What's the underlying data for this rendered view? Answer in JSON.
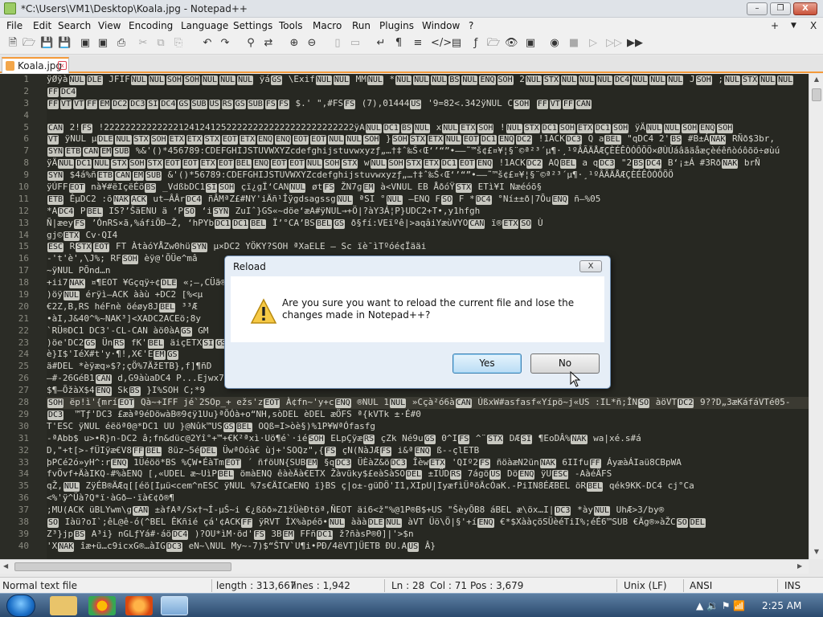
{
  "window": {
    "title": "*C:\\Users\\VM1\\Desktop\\Koala.jpg - Notepad++",
    "minimize": "–",
    "maximize": "❐",
    "close": "X"
  },
  "menu": [
    "File",
    "Edit",
    "Search",
    "View",
    "Encoding",
    "Language",
    "Settings",
    "Tools",
    "Macro",
    "Run",
    "Plugins",
    "Window",
    "?"
  ],
  "menu_right": {
    "plus": "+",
    "down": "▼",
    "close": "X"
  },
  "tab": {
    "label": "Koala.jpg",
    "close": "x"
  },
  "toolbar_icons": [
    "new-file-icon",
    "open-file-icon",
    "save-icon",
    "save-all-icon",
    "close-icon",
    "close-all-icon",
    "print-icon",
    "cut-icon",
    "copy-icon",
    "paste-icon",
    "undo-icon",
    "redo-icon",
    "find-icon",
    "replace-icon",
    "zoom-in-icon",
    "zoom-out-icon",
    "sync-v-icon",
    "sync-h-icon",
    "word-wrap-icon",
    "show-all-chars-icon",
    "indent-guide-icon",
    "udl-icon",
    "doc-map-icon",
    "function-list-icon",
    "folder-workspace-icon",
    "monitoring-icon",
    "record-macro-icon",
    "stop-record-icon",
    "play-macro-icon",
    "run-macro-multiple-icon",
    "save-macro-icon"
  ],
  "line_numbers": [
    "1",
    "2",
    "3",
    "4",
    "5",
    "6",
    "7",
    "8",
    "9",
    "10",
    "11",
    "12",
    "13",
    "14",
    "15",
    "16",
    "17",
    "18",
    "19",
    "20",
    "21",
    "22",
    "23",
    "24",
    "25",
    "26",
    "27",
    "28",
    "29",
    "30",
    "31",
    "32",
    "33",
    "34",
    "35",
    "36",
    "37",
    "38",
    "39",
    "40"
  ],
  "code_lines": [
    "ÿØÿà NUL DLE JFIF NUL NUL SOH SOH NUL NUL NUL ÿá GS \\Exif NUL NUL MM NUL * NUL NUL NUL BS NUL ENQ SOH 2 NUL STX NUL NUL NUL DC4 NUL NUL NUL J SOH ; NUL STX NUL NUL",
    "FF DC4",
    "FF VT VT FF EM DC2 DC3 SI DC4 GS SUB US RS GS SUB FS FS $.' \",#FS FS (7),01444 US '9=82<.342ÿNUL C SOH         FF VT FF CAN",
    "",
    "CAN 2! FS !22222222222222124124125222222222222222222222222ÿA NUL DC1 BS NUL x NUL ETX SOH ! NUL STX DC1 SOH ETX DC1 SOH ÿÄ NUL NUL SOH ENQ SOH",
    "VT ÿNUL µ DLE NUL STX SOH ETX ETX STX EOT ETX ENQ ENQ EOT EOT NUL NUL SOH } SOH STX ETX NUL EOT DC1 ENQ DC2 !1ACK DC3 Q a BEL \"qDC4 2' BS #B±Á NAK RÑð$3br,",
    "SYN ETB CAN EM SUB %&'()*456789:CDEFGHIJSTUVWXYZcdefghijstuvwxyzƒ„…†‡ˆ‰Š‹Œ‘’“”•–—˜™š¢£¤¥¦§¨©ª²³´µ¶·¸¹ºÂÃÄÅÆÇÈÉÊÒÓÔÕÖ×ØÙÚáâãäåæçèéêñòóôõö÷øùú",
    "ÿÄ NUL DC1 NUL STX SOH STX EOT EOT ETX EOT BEL ENQ EOT EOT NUL SOH STX w NUL SOH STX ETX DC1 EOT ENQ !1ACK DC2 AQ BEL a q DC3 \"2 BS DC4 B‘¡±Á  #3Rð NAK brÑ",
    "SYN $4á%ñ ETB CAN EM SUB &'()*56789:CDEFGHIJSTUVWXYZcdefghijstuvwxyzƒ„…†‡ˆ‰Š‹Œ‘’“”•–—˜™š¢£¤¥¦§¨©ª²³´µ¶·¸¹ºÂÃÄÅÆÇÈÉÊÒÓÔÕÖ",
    "ÿÚFF EOT nà¥#ëIçëÉö BS _VdßbDC1 SI SOH çï¿gÏ‘CAN NUL øt FS ŽN7g EM à<VNUL EB ÅðóŸ STX ETì¥I Næéóõ§",
    "ETB ÊµDC2 :õ NAK ACK ut–ÂÂr DC4 ñÂMªZ£#NY'iÄñ¹Îÿgdsagssg NUL ªSI ° NUL —ENQ F SO F * DC4 °Ní±±ð|7Õu ENQ ñ–%05",
    "*A DC4 P BEL IS?’ŠäENU ä ‘P SO ‘i SYN ZuIˆ}GS«~döe‘æA#ÿNUL→+Ö|?àY3Á¦P}UDC2+T•,y1hfgh",
    "Ñ|æey FS ’ÓnRS×ã,%áfiÖÐ–Ž,  ‘hPYb DC1 DC1 BEL Ï’°CA’BS BEL GS ð§fí:VEïºê|>aqâiYæùVYO CAN ï® ETX SO Ù",
    "gj© ETX Cv·QI4",
    "ESC R STX EOT FT ÀtàóYÅZw0hü SYN µ×DC2 YÖKY?SOH ªXaELE – Sc ïè¯ìTºóé¢Ïääi",
    "-'t'è',\\J%; RF SOH èÿ@'ÕÜe^mâ",
    "~ÿNUL PÕnd…n",
    "+ii7 NAK ¤¶EOT ¥Gçqÿ÷¢ DLE «;–,CÜã®@",
    ")öÿ NUL érÿì–ACK ààù +DC2 [%<µ",
    "€2Z,B,RS héFnè   öéøy8J BEL ³³Æ",
    "•àI,J&40^%~NAK³]<XADC2ACEö;8y",
    "`RÜ®DC1 DC3'-CL-CAN àö0àA GS GM",
    ")öe'DC2 GS Ün RS fK' BEL äiçETX SI GS",
    "   è}I$'IéX#t'y·¶!,X€'E EM GS",
    "ä#DEL *èÿæq»$?;çÖ%7ÄžETB},f]¶ñD",
    "—#-26GéB1 CAN d,G9àùaDC4 P...Ejwx76",
    "$¶—ÕžàX$4 ENQ Sk BS }I%SOH C;*9",
    "SOH ëp!ì'{mrí EOT Qà~+IFF jé`2SOp_+ ežs'z EOT À¢fn~'y+c ENQ ®NUL 1 NUL »Cçà²ó6à CAN ÚßxW#asfasf«Yípö~j«US :IL*ñ;ÎN SO àöVT DC2 9??D„3æKáfáVTé05-",
    "DC3  ™Tƒ'DC3 £æàª9éDöwàB®9¢ÿ1Uu}ªÕÓà+o“NH,sòDEL èDEL æÖFS ª{kVTk ±·É#0",
    "T'ESC ÿNUL éëöª0@*DC1 UU }@Nûk™US GS BEL OQß=I>òè§)%1P¥WªÓfasfg",
    "-ªAbb$ u>•R}n-DC2 â;fn&düc@2Yî°+™+€K²ªxì·Uö¶é`·ié SOH ELpÇÿæ RS çZk Né9u GS 0^I FS ^¨ STX DÆ SI ¶EoDÂ% NAK wa|xé.s#á",
    "D,\"+t[>-fÜIÿæ€V8 FF BEL 8üz~5é DEL ÜwªOóà€ ùj+'SOQz\",{ FS çN(NàJÆ FS i&ª ENQ ß--çlETB",
    "þPCé2ó»yH^:r ENQ 1Üéöö*BS %ÇW•ÉàTm EOT ´ ñföUN{SUB EM §q DC3 ÜÈàZ&ö DC3 Îèw ETX 'QIº2 FS ñöàæN2ün NAK 6IIfu FF   ÁyæàÁIaü8CBpWA",
    "fvÖvf+ÄàIKQ-#%àENQ [,«UDEL æ~UìP BEL ömàENQ êàèÄà€ETX Žàvüky$£eàSàSO DEL ±IÜD RS 7ágö US Dö ENQ ÿU ESC -AàéÄFS",
    "qŽ, NUL ZÿÉB®ÄÆq[[éö[Iµü<cem^nESC ÿNUL %7s€ÄICæENQ ï}BS ç|o±-güDÖ'I1,XIpU|IyæfìÜªöÄcÓaK.-PiIN8ÉÆBEL öR BEL qék9KK-DC4 cj°Ca",
    "<%'ÿ^Üà?Q*ï·àGð—·ïà€¢ð®¶",
    ";MU(ACK üBLYwm\\g CAN ±àfAª/Sx†¬Í-µŠ~i €¿ßöð»Z1žÜèÐtöª,ÑEOT äi6<ž\"%@1P®B$+US \"ŠèyÕB8 áBEL æ\\öx…I| DC3 *ày NUL UhÆ>3/by®",
    "SO Iàü?oI`;êL@ê-ó(^BEL ÊKñié   çá'¢ACK FF ÿRVT ÌX%àpéö• NUL ààà DLE NUL àVT Üö\\Ö|§'+í ENQ €*$XààçöSÜèéTiI%;éÉ6™SUB €Äg®»àŽC SO DEL",
    "Z³}jp BS A³i} nGLƒYá#·áö DC4 )?OU*ìM·öd' FS 3B EM FFñ DC1 ž?ñàsP®0]|'>$n",
    "'X NAK îæ+ü…c9icxG®…àIG DC3 eN~\\NUL My~-7)$“ŠTV`U¶i•PÐ/4ëVT]ÜETB ÐU.A US Â}"
  ],
  "dialog": {
    "title": "Reload",
    "close": "X",
    "message": "Are you sure you want to reload the current file and lose the changes made in Notepad++?",
    "yes": "Yes",
    "no": "No"
  },
  "status": {
    "file_type": "Normal text file",
    "length": "length : 313,667",
    "lines": "lines : 1,942",
    "ln": "Ln : 28",
    "col": "Col : 71",
    "pos": "Pos : 3,679",
    "eol": "Unix (LF)",
    "encoding": "ANSI",
    "mode": "INS"
  },
  "taskbar": {
    "clock": "2:25 AM"
  },
  "colors": {
    "accent_tab": "#f49a3a",
    "editor_bg": "#272822",
    "control_char_bg": "#c8c8c0"
  }
}
